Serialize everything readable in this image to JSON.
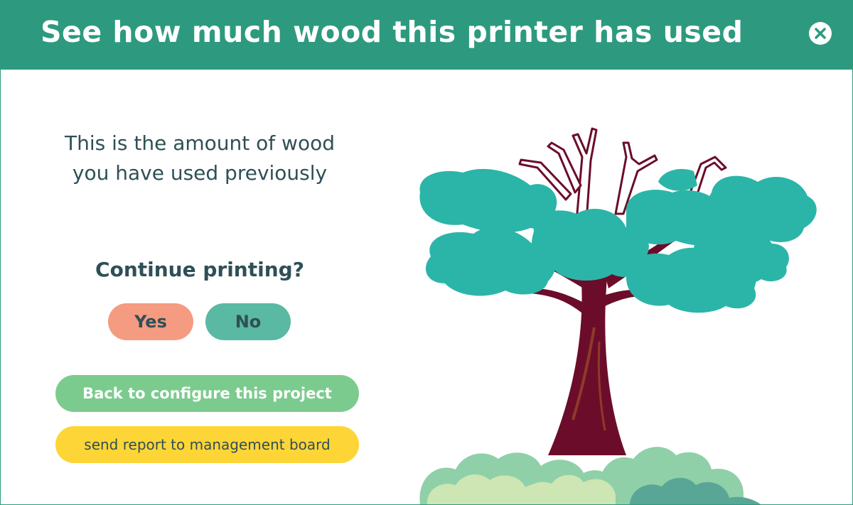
{
  "dialog": {
    "title": "See how much wood this printer has used",
    "close_icon": "close-icon"
  },
  "main": {
    "message": "This is the amount of wood you have used previously",
    "question": "Continue printing?",
    "yes_label": "Yes",
    "no_label": "No",
    "back_label": "Back to configure this project",
    "report_label": "send report to management board"
  },
  "illustration": {
    "name": "tree-illustration",
    "colors": {
      "leaves": "#2bb5a8",
      "trunk": "#6b0d2a",
      "bushes_light": "#cde6b3",
      "bushes_mid": "#8fd0a8",
      "bushes_dark": "#5aa696"
    }
  },
  "theme": {
    "header": "#2d9a7f",
    "yes": "#f59b82",
    "no": "#5ab9a2",
    "back": "#7ccb8e",
    "report": "#fdd536",
    "text": "#2f4f56"
  }
}
